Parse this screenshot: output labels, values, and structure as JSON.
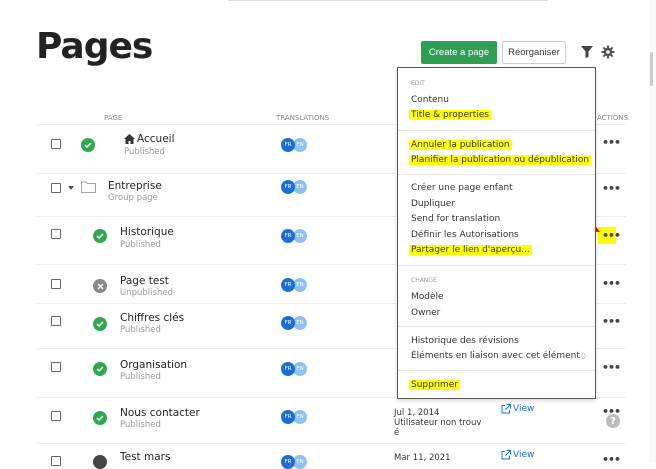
{
  "header": {
    "title": "Pages",
    "create_label": "Create a page",
    "reorganise_label": "Réorganiser"
  },
  "columns": {
    "page": "PAGE",
    "translations": "TRANSLATIONS",
    "actions": "ACTIONS"
  },
  "rows": [
    {
      "name": "Accueil",
      "status": "Published",
      "state": "published",
      "icon": "home-icon"
    },
    {
      "name": "Entreprise",
      "status": "Group page",
      "state": "group",
      "icon": "folder-icon"
    },
    {
      "name": "Historique",
      "status": "Published",
      "state": "published"
    },
    {
      "name": "Page test",
      "status": "Unpublished",
      "state": "unpublished"
    },
    {
      "name": "Chiffres clés",
      "status": "Published",
      "state": "published"
    },
    {
      "name": "Organisation",
      "status": "Published",
      "state": "published"
    },
    {
      "name": "Nous contacter",
      "status": "Published",
      "state": "published"
    },
    {
      "name": "Test mars",
      "status": "",
      "state": "dark"
    }
  ],
  "translations": {
    "fr": "FR",
    "en": "EN"
  },
  "menu": {
    "edit_heading": "EDIT",
    "contenu": "Contenu",
    "title_properties": "Title & properties",
    "annuler": "Annuler la publication",
    "planifier": "Planifier la publication ou dépublication",
    "creer": "Créer une page enfant",
    "dupliquer": "Dupliquer",
    "send": "Send for translation",
    "definir": "Définir les Autorisations",
    "partager": "Partager le lien d'aperçu...",
    "change_heading": "CHANGE",
    "modele": "Modèle",
    "owner": "Owner",
    "historique": "Historique des révisions",
    "elements": "Éléments en liaison avec cet élément",
    "elements_count": "0",
    "supprimer": "Supprimer"
  },
  "meta": {
    "row7_date": "Jul 1, 2014",
    "row7_user_line1": "Utilisateur non trouv",
    "row7_user_line2": "é",
    "row8_date": "Mar 11, 2021",
    "view": "View"
  },
  "colors": {
    "accent_green": "#2e9e55",
    "highlight": "#ffff00",
    "fr_badge": "#1a6fd6",
    "en_badge": "#8ec1f2"
  }
}
